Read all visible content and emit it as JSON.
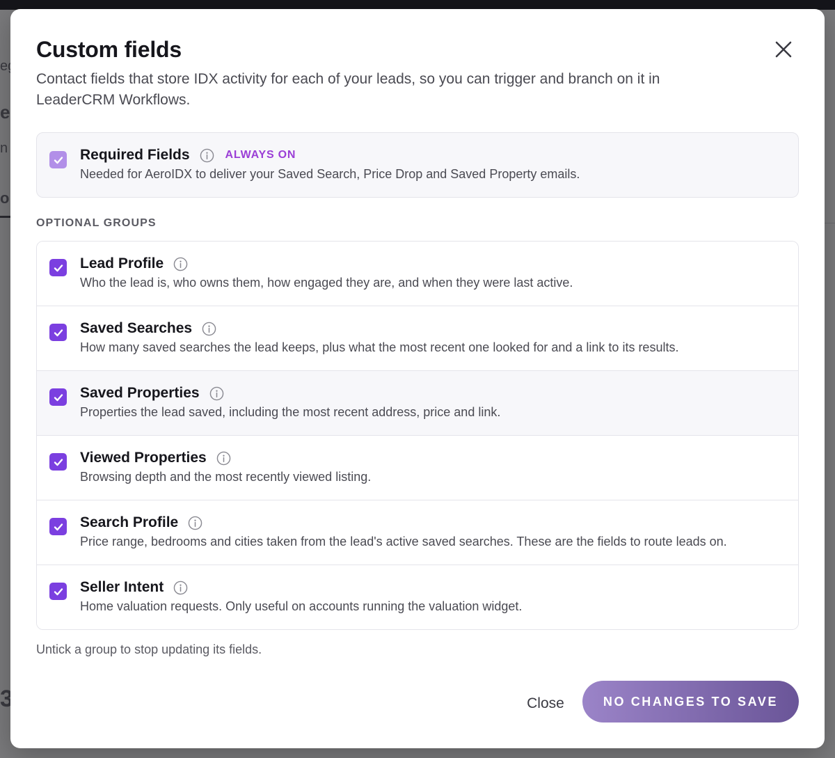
{
  "modal": {
    "title": "Custom fields",
    "subtitle": "Contact fields that store IDX activity for each of your leads, so you can trigger and branch on it in LeaderCRM Workflows.",
    "close_icon": "close-icon"
  },
  "required": {
    "title": "Required Fields",
    "badge": "ALWAYS ON",
    "description": "Needed for AeroIDX to deliver your Saved Search, Price Drop and Saved Property emails.",
    "checked": true,
    "disabled": true
  },
  "optional_label": "OPTIONAL GROUPS",
  "groups": [
    {
      "title": "Lead Profile",
      "description": "Who the lead is, who owns them, how engaged they are, and when they were last active.",
      "checked": true
    },
    {
      "title": "Saved Searches",
      "description": "How many saved searches the lead keeps, plus what the most recent one looked for and a link to its results.",
      "checked": true
    },
    {
      "title": "Saved Properties",
      "description": "Properties the lead saved, including the most recent address, price and link.",
      "checked": true
    },
    {
      "title": "Viewed Properties",
      "description": "Browsing depth and the most recently viewed listing.",
      "checked": true
    },
    {
      "title": "Search Profile",
      "description": "Price range, bedrooms and cities taken from the lead's active saved searches. These are the fields to route leads on.",
      "checked": true
    },
    {
      "title": "Seller Intent",
      "description": "Home valuation requests. Only useful on accounts running the valuation widget.",
      "checked": true
    }
  ],
  "footnote": "Untick a group to stop updating its fields.",
  "buttons": {
    "close_label": "Close",
    "save_label": "NO CHANGES TO SAVE"
  },
  "background": {
    "frag_1": "eg",
    "frag_2": "ea",
    "frag_3": "n",
    "frag_4": "o",
    "frag_5": "3"
  },
  "colors": {
    "accent": "#7b3fe0",
    "badge": "#9b3fd6",
    "save_start": "#9b84c8",
    "save_end": "#6a5598"
  }
}
